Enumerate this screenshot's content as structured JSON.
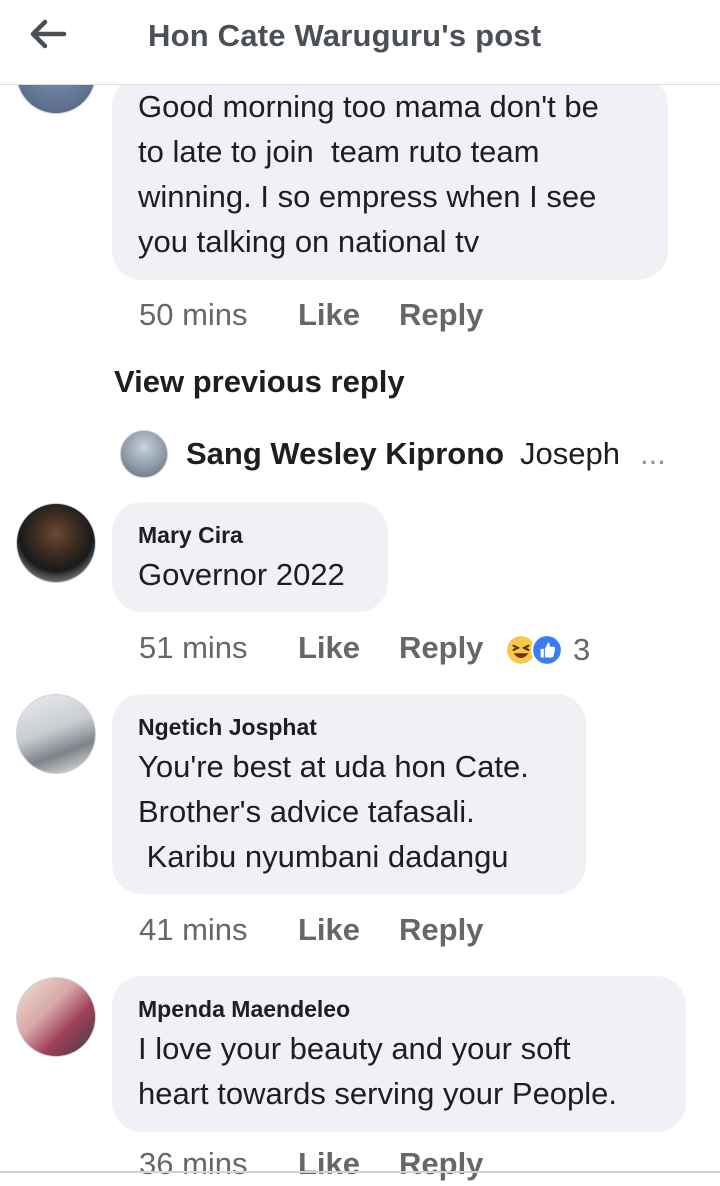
{
  "header": {
    "title": "Hon Cate Waruguru's post",
    "back_icon": "arrow-left-icon"
  },
  "comments": [
    {
      "author": "",
      "text": "Good morning too mama don't be\nto late to join  team ruto team\nwinning. I so empress when I see\nyou talking on national tv",
      "time": "50 mins",
      "like": "Like",
      "reply": "Reply"
    },
    {
      "author": "Mary Cira",
      "text": "Governor 2022",
      "time": "51 mins",
      "like": "Like",
      "reply": "Reply",
      "reaction_count": "3",
      "reaction_icons": [
        "laugh-icon",
        "like-icon"
      ]
    },
    {
      "author": "Ngetich Josphat",
      "text": "You're best at uda hon Cate.\nBrother's advice tafasali.\n Karibu nyumbani dadangu",
      "time": "41 mins",
      "like": "Like",
      "reply": "Reply"
    },
    {
      "author": "Mpenda Maendeleo",
      "text": "I love your beauty and your soft\nheart towards serving your People.",
      "time": "36 mins",
      "like": "Like",
      "reply": "Reply"
    }
  ],
  "view_previous": "View previous reply",
  "reply_preview": {
    "name": "Sang Wesley Kiprono",
    "text": "Joseph",
    "ellipsis": "..."
  },
  "colors": {
    "bubble": "#eff1f4",
    "meta": "#65676b",
    "text": "#1c1e21",
    "header_title": "#4b4f56"
  }
}
